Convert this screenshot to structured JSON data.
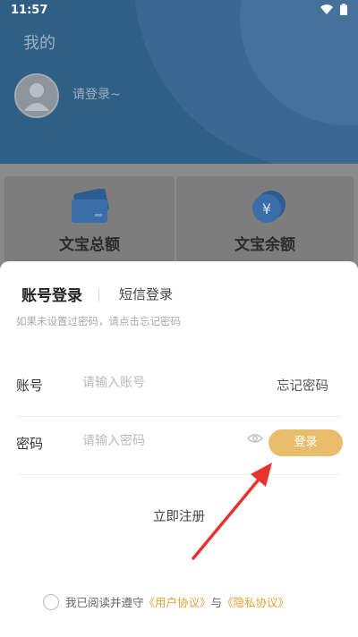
{
  "status_bar": {
    "time": "11:57"
  },
  "profile": {
    "page_title": "我的",
    "login_prompt": "请登录~"
  },
  "cards": [
    {
      "label": "文宝总额",
      "icon": "card-icon"
    },
    {
      "label": "文宝余额",
      "icon": "yen-coin-icon"
    }
  ],
  "login": {
    "tab_account": "账号登录",
    "tab_sms": "短信登录",
    "hint": "如果未设置过密码，请点击忘记密码",
    "account_label": "账号",
    "account_placeholder": "请输入账号",
    "forgot_password": "忘记密码",
    "password_label": "密码",
    "password_placeholder": "请输入密码",
    "login_button": "登录",
    "register": "立即注册",
    "agree_prefix": "我已阅读并遵守",
    "user_agreement": "《用户协议》",
    "agree_and": "与",
    "privacy_policy": "《隐私协议》"
  },
  "colors": {
    "header_blue": "#305f85",
    "login_gold": "#e8be6c",
    "link_gold": "#e0a537",
    "arrow_red": "#e8342e"
  }
}
